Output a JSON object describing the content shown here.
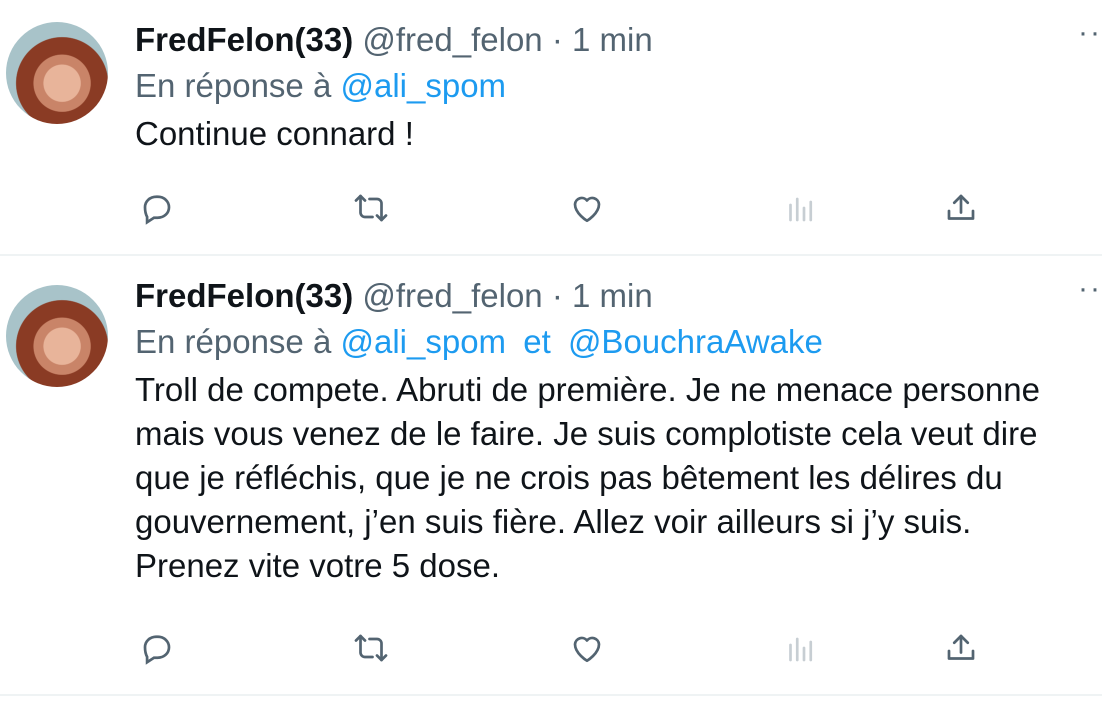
{
  "tweets": [
    {
      "author": "FredFelon(33)",
      "handle": "@fred_felon",
      "separator": "·",
      "time": "1 min",
      "reply_prefix": "En réponse à",
      "mentions": [
        "@ali_spom"
      ],
      "text": "Continue connard !",
      "more": "··"
    },
    {
      "author": "FredFelon(33)",
      "handle": "@fred_felon",
      "separator": "·",
      "time": "1 min",
      "reply_prefix": "En réponse à",
      "mentions": [
        "@ali_spom",
        "@BouchraAwake"
      ],
      "mention_joiner": "et",
      "text": "Troll de compete. Abruti de première. Je ne menace personne\nmais vous venez de le faire. Je suis complotiste cela veut dire\nque je réfléchis, que je ne crois pas bêtement les délires du\ngouvernement, j’en suis fière. Allez voir ailleurs si j’y suis.\nPrenez vite votre 5 dose.",
      "more": "··"
    }
  ],
  "icons": [
    "reply-icon",
    "retweet-icon",
    "like-icon",
    "views-icon",
    "share-icon"
  ],
  "colors": {
    "mention": "#1d9bf0",
    "secondary_text": "#536471",
    "primary_text": "#0f1419",
    "divider": "#eff3f4"
  }
}
